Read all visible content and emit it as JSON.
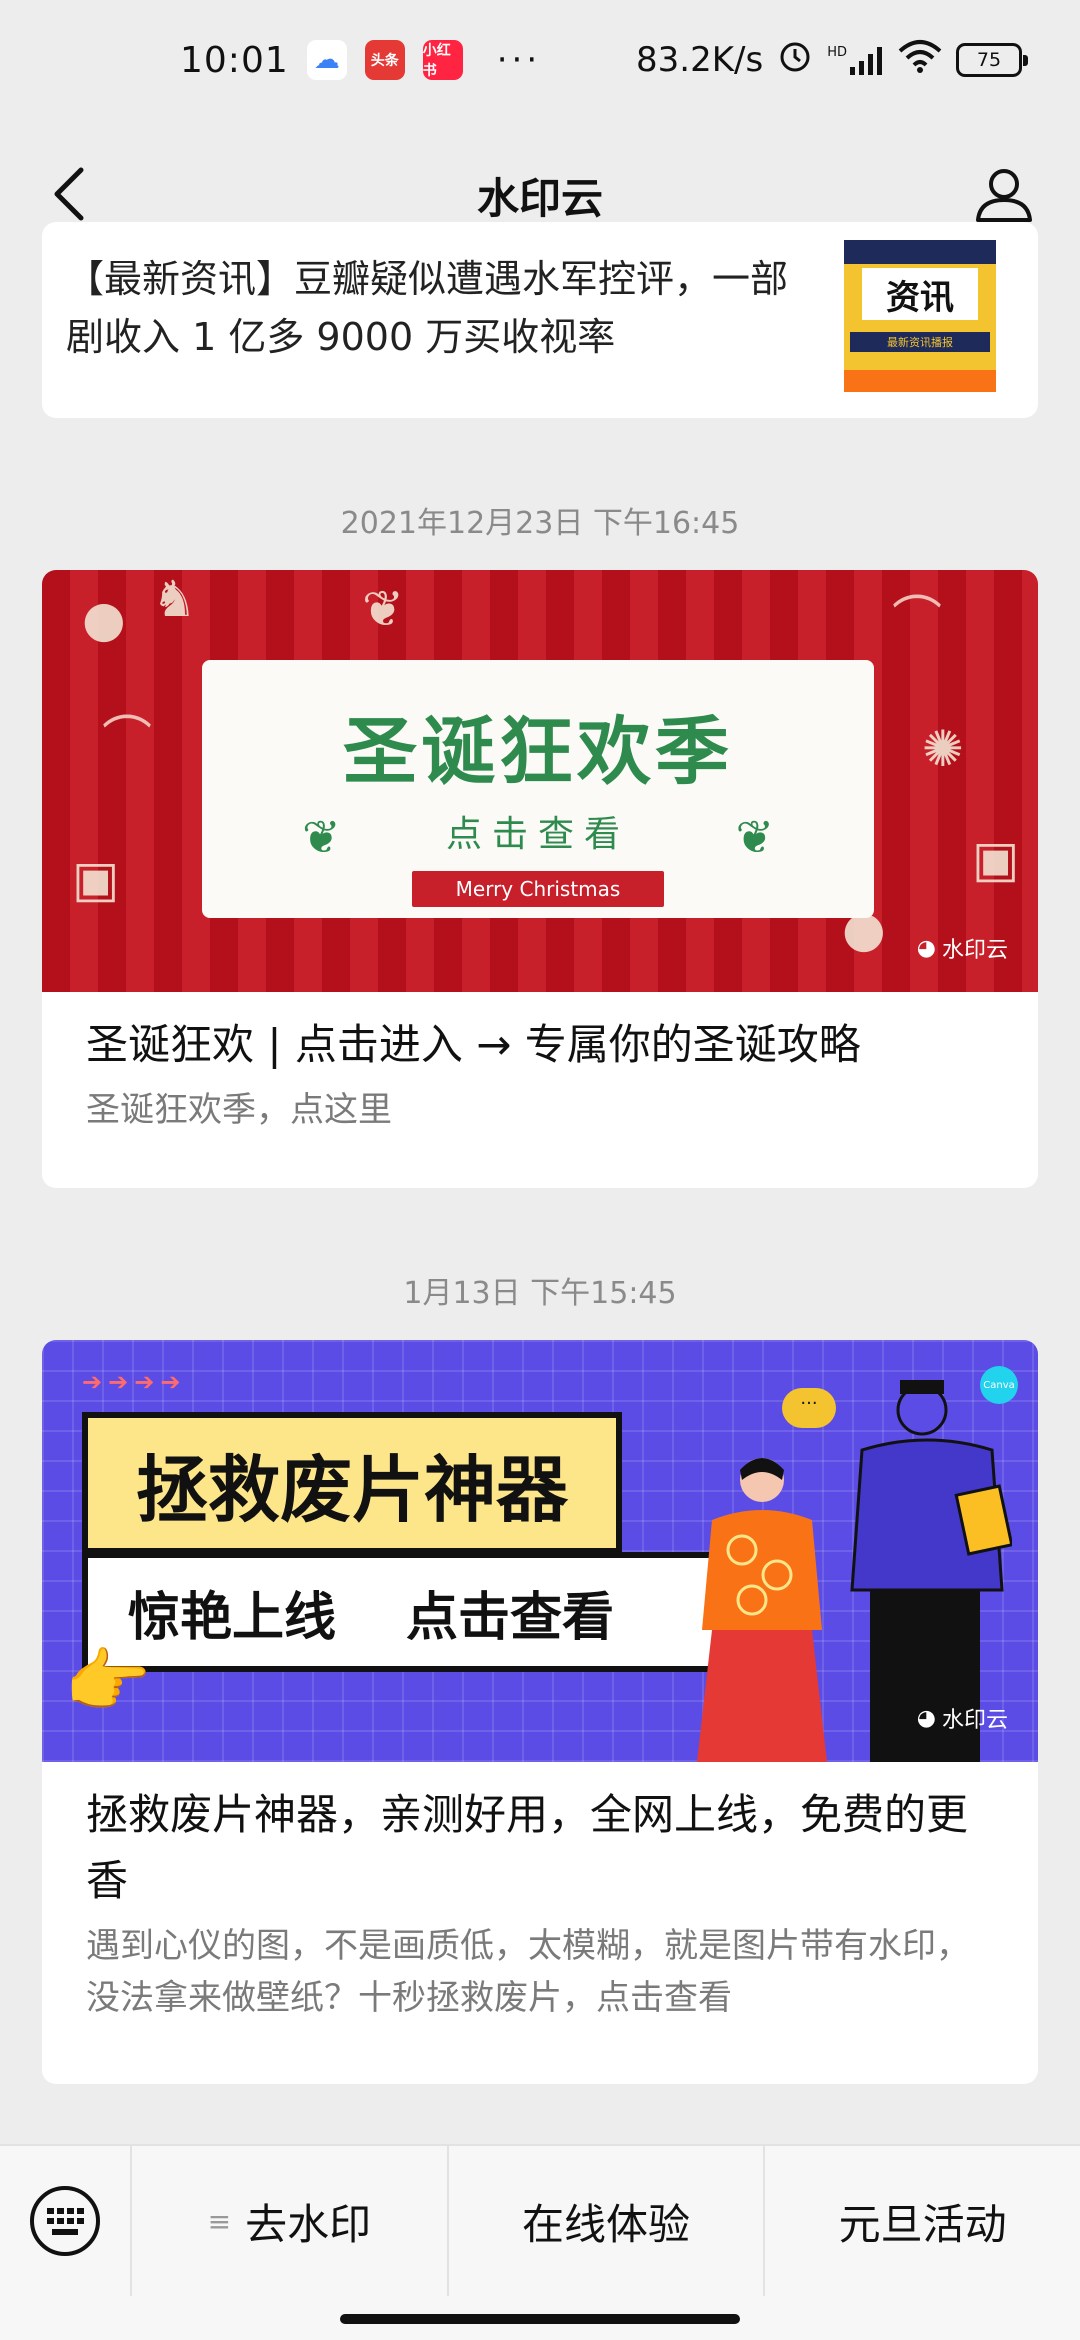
{
  "status_bar": {
    "time": "10:01",
    "app_toutiao": "头条",
    "app_xhs": "小红书",
    "dots": "···",
    "net_speed": "83.2K/s",
    "signal_label": "HD",
    "battery": "75"
  },
  "nav": {
    "title": "水印云"
  },
  "feed": {
    "news_card": {
      "title": "【最新资讯】豆瓣疑似遭遇水军控评，一部剧收入 1 亿多 9000 万买收视率",
      "thumb_main": "资讯",
      "thumb_sub": "最新资讯播报"
    },
    "timestamp_1": "2021年12月23日 下午16:45",
    "article_1": {
      "banner_title": "圣诞狂欢季",
      "banner_sub": "点击查看",
      "banner_ribbon": "Merry Christmas",
      "watermark": "水印云",
      "title": "圣诞狂欢 | 点击进入 → 专属你的圣诞攻略",
      "desc": "圣诞狂欢季，点这里"
    },
    "timestamp_2": "1月13日 下午15:45",
    "article_2": {
      "banner_title": "拯救废片神器",
      "banner_line_a": "惊艳上线",
      "banner_line_b": "点击查看",
      "banner_badge": "Canva",
      "watermark": "水印云",
      "title": "拯救废片神器，亲测好用，全网上线，免费的更香",
      "desc": "遇到心仪的图，不是画质低，太模糊，就是图片带有水印，没法拿来做壁纸？十秒拯救废片，点击查看"
    }
  },
  "bottom_menu": {
    "items": [
      "去水印",
      "在线体验",
      "元旦活动"
    ]
  },
  "colors": {
    "background": "#ededed",
    "christmas_red": "#c8202a",
    "christmas_green": "#2f8a4e",
    "purple_banner": "#5b4ce6"
  }
}
